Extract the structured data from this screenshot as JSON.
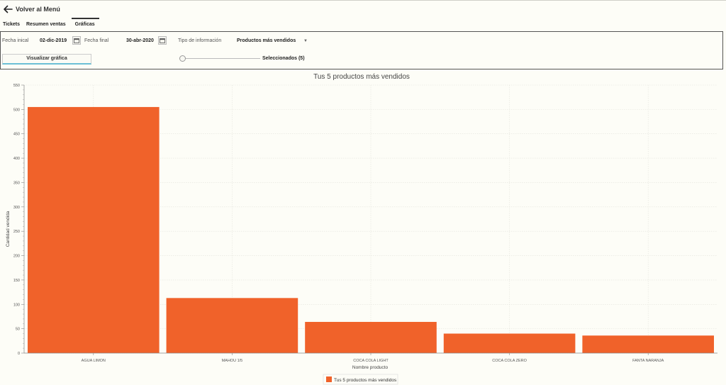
{
  "header": {
    "back_label": "Volver al Menú"
  },
  "tabs": [
    {
      "label": "Tickets"
    },
    {
      "label": "Resumen ventas"
    },
    {
      "label": "Gráficas"
    }
  ],
  "filters": {
    "start_label": "Fecha inical",
    "start_value": "02-dic-2019",
    "end_label": "Fecha final",
    "end_value": "30-abr-2020",
    "info_label": "Tipo de información",
    "info_value": "Productos más vendidos",
    "visualize_label": "Visualizar gráfica",
    "selected_label": "Seleccionados (5)"
  },
  "chart_data": {
    "type": "bar",
    "title": "Tus 5 productos más vendidos",
    "xlabel": "Nombre producto",
    "ylabel": "Cantidad vendida",
    "categories": [
      "AGUA LIMON",
      "MAHOU 1/5",
      "COCA COLA LIGHT",
      "COCA COLA ZERO",
      "FANTA NARANJA"
    ],
    "series": [
      {
        "name": "Tus 5 productos más vendidos",
        "values": [
          505,
          113,
          64,
          40,
          36
        ],
        "color": "#f0622a"
      }
    ],
    "ylim": [
      0,
      550
    ],
    "yticks": [
      "0",
      "50",
      "100",
      "150",
      "200",
      "250",
      "300",
      "350",
      "400",
      "450",
      "500",
      "550"
    ],
    "grid": true,
    "legend": "bottom-center"
  }
}
